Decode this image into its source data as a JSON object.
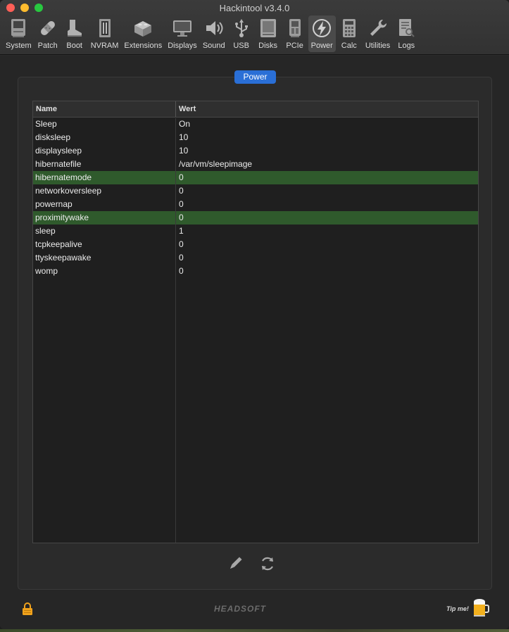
{
  "window": {
    "title": "Hackintool v3.4.0"
  },
  "toolbar": {
    "items": [
      {
        "label": "System",
        "icon": "computer-icon"
      },
      {
        "label": "Patch",
        "icon": "bandage-icon"
      },
      {
        "label": "Boot",
        "icon": "boot-icon"
      },
      {
        "label": "NVRAM",
        "icon": "ram-chip-icon"
      },
      {
        "label": "Extensions",
        "icon": "lego-brick-icon"
      },
      {
        "label": "Displays",
        "icon": "monitor-icon"
      },
      {
        "label": "Sound",
        "icon": "speaker-icon"
      },
      {
        "label": "USB",
        "icon": "usb-icon"
      },
      {
        "label": "Disks",
        "icon": "disk-icon"
      },
      {
        "label": "PCIe",
        "icon": "pcie-card-icon"
      },
      {
        "label": "Power",
        "icon": "power-bolt-icon",
        "active": true
      },
      {
        "label": "Calc",
        "icon": "calculator-icon"
      },
      {
        "label": "Utilities",
        "icon": "wrench-icon"
      },
      {
        "label": "Logs",
        "icon": "log-file-icon"
      }
    ]
  },
  "power_panel": {
    "tab_label": "Power",
    "columns": {
      "name": "Name",
      "value": "Wert"
    },
    "rows": [
      {
        "name": "Sleep",
        "value": "On"
      },
      {
        "name": "disksleep",
        "value": "10"
      },
      {
        "name": "displaysleep",
        "value": "10"
      },
      {
        "name": "hibernatefile",
        "value": "/var/vm/sleepimage"
      },
      {
        "name": "hibernatemode",
        "value": "0",
        "highlighted": true
      },
      {
        "name": "networkoversleep",
        "value": "0"
      },
      {
        "name": "powernap",
        "value": "0"
      },
      {
        "name": "proximitywake",
        "value": "0",
        "highlighted": true
      },
      {
        "name": "sleep",
        "value": "1"
      },
      {
        "name": "tcpkeepalive",
        "value": "0"
      },
      {
        "name": "ttyskeepawake",
        "value": "0"
      },
      {
        "name": "womp",
        "value": "0"
      }
    ],
    "actions": {
      "edit_icon": "pencil-icon",
      "refresh_icon": "refresh-icon"
    }
  },
  "footer": {
    "brand": "HEADSOFT",
    "tip_label": "Tip me!",
    "lock_icon": "lock-icon",
    "beer_icon": "beer-mug-icon"
  },
  "colors": {
    "accent_blue": "#2a6fd6",
    "row_highlight": "#2f5a2c",
    "lock_orange": "#f0a21c"
  }
}
